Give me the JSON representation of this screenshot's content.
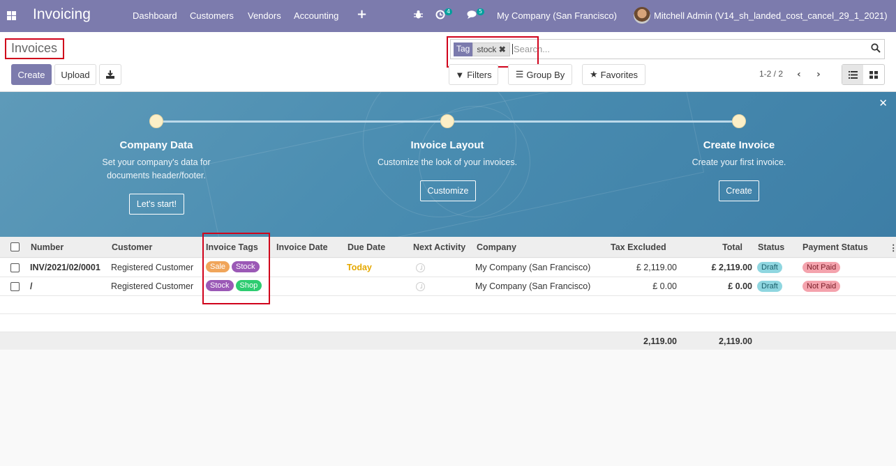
{
  "topbar": {
    "app_name": "Invoicing",
    "menu": [
      "Dashboard",
      "Customers",
      "Vendors",
      "Accounting"
    ],
    "plus": "+",
    "activity_count": "4",
    "message_count": "5",
    "company": "My Company (San Francisco)",
    "user": "Mitchell Admin (V14_sh_landed_cost_cancel_29_1_2021)"
  },
  "control_panel": {
    "title": "Invoices",
    "create": "Create",
    "upload": "Upload",
    "search": {
      "facet_key": "Tag",
      "facet_value": "stock",
      "placeholder": "Search..."
    },
    "filters": "Filters",
    "group_by": "Group By",
    "favorites": "Favorites",
    "pager": "1-2 / 2"
  },
  "banner": {
    "steps": [
      {
        "title": "Company Data",
        "desc1": "Set your company's data for",
        "desc2": "documents header/footer.",
        "button": "Let's start!"
      },
      {
        "title": "Invoice Layout",
        "desc1": "Customize the look of your invoices.",
        "desc2": "",
        "button": "Customize"
      },
      {
        "title": "Create Invoice",
        "desc1": "Create your first invoice.",
        "desc2": "",
        "button": "Create"
      }
    ]
  },
  "table": {
    "headers": [
      "Number",
      "Customer",
      "Invoice Tags",
      "Invoice Date",
      "Due Date",
      "Next Activity",
      "Company",
      "Tax Excluded",
      "Total",
      "Status",
      "Payment Status"
    ],
    "rows": [
      {
        "number": "INV/2021/02/0001",
        "customer": "Registered Customer",
        "tags": [
          "Sale",
          "Stock"
        ],
        "invoice_date": "",
        "due_date": "Today",
        "company": "My Company (San Francisco)",
        "tax_excluded": "£ 2,119.00",
        "total": "£ 2,119.00",
        "status": "Draft",
        "payment_status": "Not Paid"
      },
      {
        "number": "/",
        "customer": "Registered Customer",
        "tags": [
          "Stock",
          "Shop"
        ],
        "invoice_date": "",
        "due_date": "",
        "company": "My Company (San Francisco)",
        "tax_excluded": "£ 0.00",
        "total": "£ 0.00",
        "status": "Draft",
        "payment_status": "Not Paid"
      }
    ],
    "totals": {
      "tax_excluded": "2,119.00",
      "total": "2,119.00"
    }
  },
  "colors": {
    "brand": "#7c7bad",
    "sale": "#f0a55a",
    "stock": "#9b59b6",
    "shop": "#2ecc71",
    "draft": "#8fd6e0",
    "not_paid": "#f4a3ad",
    "today": "#e5a800",
    "highlight": "#d0021b"
  }
}
